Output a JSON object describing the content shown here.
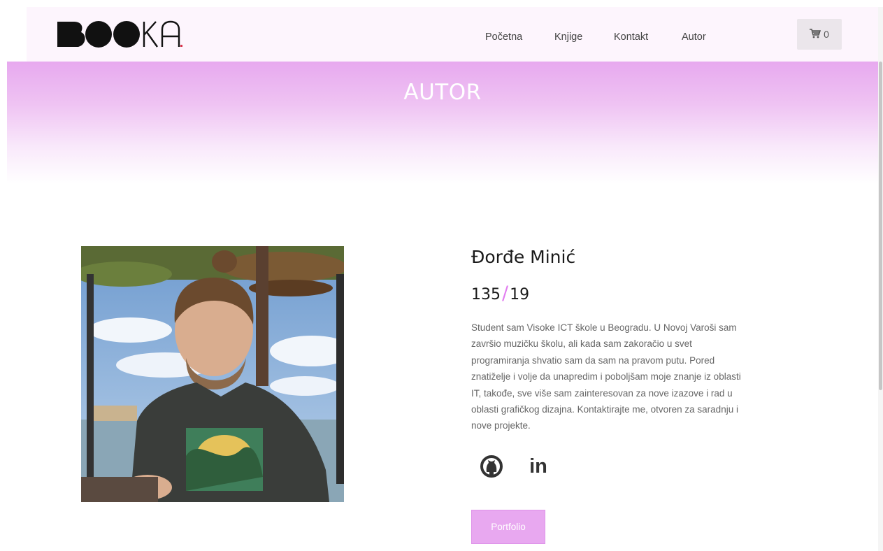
{
  "brand": {
    "logo_text": "BOOKA",
    "accent_color": "#e27ef0",
    "hero_color": "#e7a9ef"
  },
  "nav": {
    "items": [
      {
        "label": "Početna"
      },
      {
        "label": "Knjige"
      },
      {
        "label": "Kontakt"
      },
      {
        "label": "Autor"
      }
    ],
    "cart": {
      "icon": "cart-icon",
      "count": "0"
    }
  },
  "hero": {
    "title": "AUTOR"
  },
  "author": {
    "name": "Đorđe Minić",
    "index_number": "135",
    "index_year": "19",
    "index_separator": "/",
    "bio_lines": [
      "Student sam Visoke ICT škole u Beogradu. U Novoj Varoši sam",
      "završio muzičku školu, ali kada sam zakoračio u svet",
      "programiranja shvatio sam da sam na pravom putu. Pored",
      "znatiželje i volje da unapredim i poboljšam moje znanje iz oblasti",
      "IT, takođe, sve više sam zainteresovan za nove izazove i rad u",
      "oblasti grafičkog dizajna. Kontaktirajte me, otvoren za saradnju i",
      "nove projekte."
    ],
    "social": [
      {
        "icon": "github-icon"
      },
      {
        "icon": "linkedin-icon",
        "label": "in"
      }
    ],
    "portfolio_button": "Portfolio",
    "photo": "author-photo"
  }
}
